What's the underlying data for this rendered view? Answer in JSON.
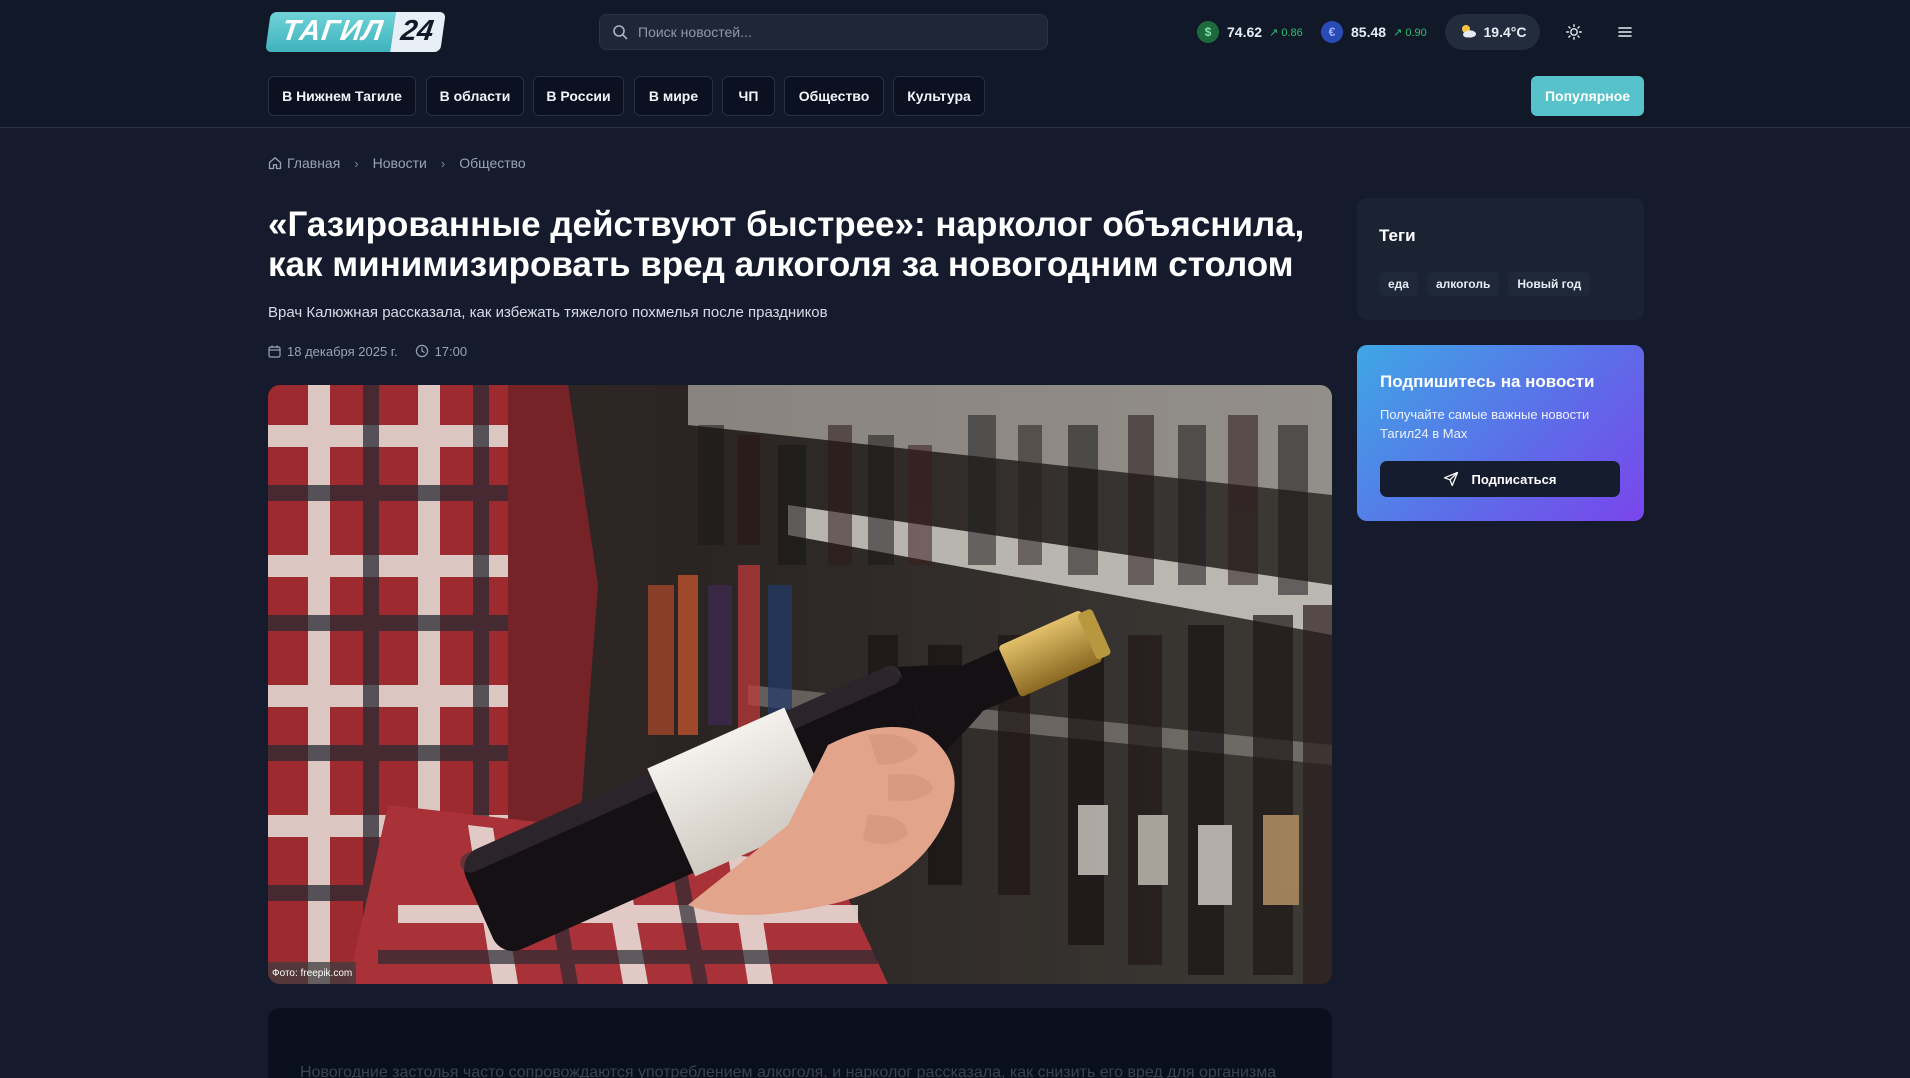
{
  "header": {
    "logo_text": "ТАГИЛ",
    "logo_number": "24",
    "search_placeholder": "Поиск новостей...",
    "rates": [
      {
        "symbol": "$",
        "value": "74.62",
        "change": "↗ 0.86",
        "color": "#22a35a"
      },
      {
        "symbol": "€",
        "value": "85.48",
        "change": "↗ 0.90",
        "color": "#2f5fd6"
      }
    ],
    "weather": {
      "icon": "sun-cloud-icon",
      "temperature": "19.4°C"
    },
    "theme_icon": "sun-icon",
    "menu_icon": "menu-icon"
  },
  "nav": {
    "items": [
      "В Нижнем Тагиле",
      "В области",
      "В России",
      "В мире",
      "ЧП",
      "Общество",
      "Культура"
    ],
    "popular_label": "Популярное"
  },
  "breadcrumb": {
    "items": [
      "Главная",
      "Новости",
      "Общество"
    ]
  },
  "article": {
    "title": "«Газированные действуют быстрее»: нарколог объяснила, как минимизировать вред алкоголя за новогодним столом",
    "subtitle": "Врач Калюжная рассказала, как избежать тяжелого похмелья после праздников",
    "date": "18 декабря 2025 г.",
    "time": "17:00",
    "photo_credit": "Фото: freepik.com",
    "body_preview": "Новогодние застолья часто сопровождаются употреблением алкоголя, и нарколог рассказала, как снизить его вред для организма"
  },
  "sidebar": {
    "tags_title": "Теги",
    "tags": [
      "еда",
      "алкоголь",
      "Новый год"
    ],
    "subscribe": {
      "title": "Подпишитесь на новости",
      "text": "Получайте самые важные новости Тагил24 в Max",
      "button": "Подписаться"
    }
  },
  "colors": {
    "background": "#151b2c",
    "header": "#111827",
    "accent": "#57c2c9",
    "positive": "#2fbf71"
  }
}
